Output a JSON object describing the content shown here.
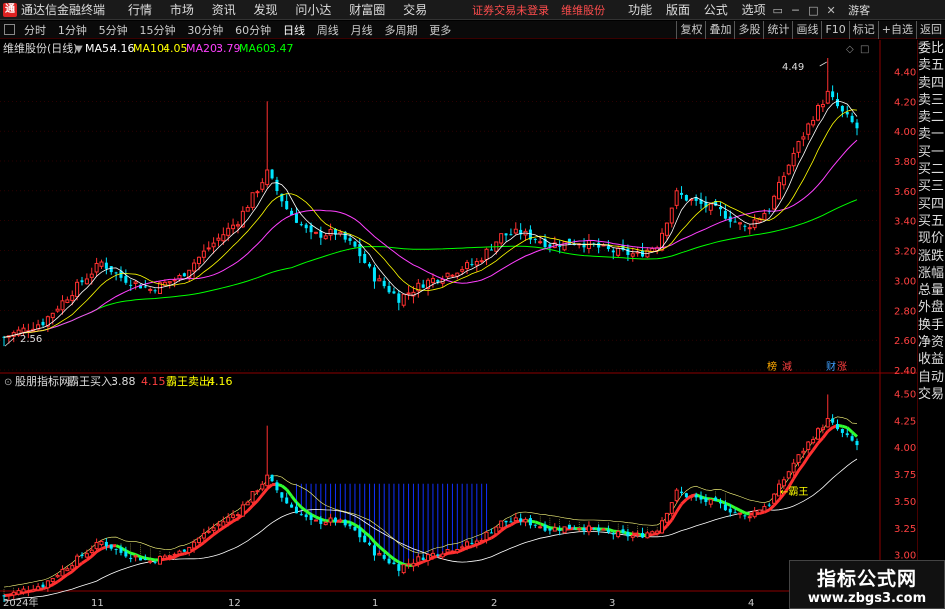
{
  "app": {
    "title": "通达信金融终端",
    "logo_text": "通"
  },
  "menu": [
    "行情",
    "市场",
    "资讯",
    "发现",
    "问小达",
    "财富圈",
    "交易"
  ],
  "notice": {
    "login": "证券交易未登录",
    "stock": "维维股份"
  },
  "right_menu": [
    "功能",
    "版面",
    "公式",
    "选项"
  ],
  "window_controls": [
    "▭",
    "─",
    "□",
    "✕"
  ],
  "guest_label": "游客",
  "periods": [
    "分时",
    "1分钟",
    "5分钟",
    "15分钟",
    "30分钟",
    "60分钟",
    "日线",
    "周线",
    "月线",
    "多周期",
    "更多"
  ],
  "active_period": "日线",
  "toolbar_right": [
    "复权",
    "叠加",
    "多股",
    "统计",
    "画线",
    "F10",
    "标记",
    "+自选",
    "返回"
  ],
  "main_panel": {
    "stock_label": "维维股份(日线)",
    "ma": [
      {
        "name": "MA5:",
        "value": "4.16",
        "color": "#ffffff"
      },
      {
        "name": "MA10:",
        "value": "4.05",
        "color": "#ffff00"
      },
      {
        "name": "MA20:",
        "value": "3.79",
        "color": "#ff40ff"
      },
      {
        "name": "MA60:",
        "value": "3.47",
        "color": "#00ff00"
      }
    ],
    "high_label": "4.49",
    "low_label": "2.56",
    "badges": [
      {
        "text": "榜",
        "color": "#ffaa00"
      },
      {
        "text": "減",
        "color": "#ff4040"
      },
      {
        "text": "财",
        "color": "#40a0ff"
      },
      {
        "text": "涨",
        "color": "#ff4040"
      }
    ]
  },
  "sub_panel": {
    "indicator_name": "股朋指标网",
    "buy_label": "霸王买入:",
    "buy_value": "3.88",
    "buy_extra": "4.15",
    "sell_label": "霸王卖出:",
    "sell_value": "4.16",
    "annotation": "←霸王"
  },
  "date_labels": [
    "2024年",
    "11",
    "12",
    "1",
    "2",
    "3",
    "4"
  ],
  "side_panel": [
    "委比",
    "卖五",
    "卖四",
    "卖三",
    "卖二",
    "卖一",
    "买一",
    "买二",
    "买三",
    "买四",
    "买五",
    "现价",
    "涨跌",
    "涨幅",
    "总量",
    "外盘",
    "换手",
    "净资",
    "收益",
    "自动",
    "交易"
  ],
  "watermark": {
    "line1": "指标公式网",
    "line2": "www.zbgs3.com"
  },
  "colors": {
    "up": "#ff3030",
    "down": "#00e5ff",
    "ma5": "#ffffff",
    "ma10": "#ffff00",
    "ma20": "#ff40ff",
    "ma60": "#00ff00",
    "grid": "#5a0000"
  },
  "chart_data": [
    {
      "type": "candlestick",
      "title": "维维股份(日线)",
      "ylim": [
        2.4,
        4.5
      ],
      "y_ticks": [
        4.4,
        4.2,
        4.0,
        3.8,
        3.6,
        3.4,
        3.2,
        3.0,
        2.8,
        2.6,
        2.4
      ],
      "x_labels": [
        "2024年",
        "11",
        "12",
        "1",
        "2",
        "3",
        "4"
      ],
      "series": [
        {
          "name": "MA5",
          "last": 4.16
        },
        {
          "name": "MA10",
          "last": 4.05
        },
        {
          "name": "MA20",
          "last": 3.79
        },
        {
          "name": "MA60",
          "last": 3.47
        }
      ],
      "close_anchors": [
        [
          0,
          2.62
        ],
        [
          8,
          2.72
        ],
        [
          15,
          2.96
        ],
        [
          20,
          3.12
        ],
        [
          24,
          3.02
        ],
        [
          30,
          2.94
        ],
        [
          36,
          3.02
        ],
        [
          42,
          3.22
        ],
        [
          48,
          3.4
        ],
        [
          54,
          3.72
        ],
        [
          58,
          3.48
        ],
        [
          63,
          3.3
        ],
        [
          68,
          3.32
        ],
        [
          72,
          3.22
        ],
        [
          76,
          3.02
        ],
        [
          81,
          2.88
        ],
        [
          86,
          2.98
        ],
        [
          92,
          3.06
        ],
        [
          97,
          3.12
        ],
        [
          102,
          3.3
        ],
        [
          106,
          3.32
        ],
        [
          112,
          3.24
        ],
        [
          118,
          3.26
        ],
        [
          124,
          3.2
        ],
        [
          130,
          3.17
        ],
        [
          134,
          3.24
        ],
        [
          138,
          3.58
        ],
        [
          142,
          3.52
        ],
        [
          147,
          3.46
        ],
        [
          152,
          3.35
        ],
        [
          157,
          3.48
        ],
        [
          162,
          3.85
        ],
        [
          166,
          4.1
        ],
        [
          169,
          4.25
        ],
        [
          172,
          4.12
        ],
        [
          175,
          4.02
        ]
      ]
    },
    {
      "type": "candlestick",
      "title": "股朋指标网",
      "ylim": [
        2.75,
        4.5
      ],
      "y_ticks": [
        4.5,
        4.25,
        4.0,
        3.75,
        3.5,
        3.25,
        3.0,
        2.75
      ],
      "series": [
        {
          "name": "霸王买入",
          "last": 3.88
        },
        {
          "name": "霸王卖出",
          "last": 4.16
        }
      ]
    }
  ]
}
